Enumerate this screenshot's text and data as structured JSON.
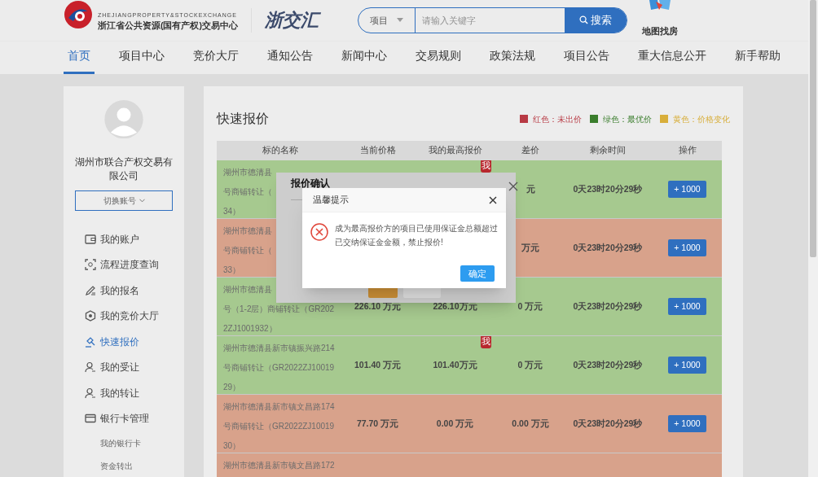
{
  "header": {
    "logo_subtitle": "ZHEJIANGPROPERTY&STOCKEXCHANGE",
    "logo_name": "浙江省公共资源(国有产权)交易中心",
    "brand": "浙交汇",
    "search": {
      "category": "项目",
      "placeholder": "请输入关键字",
      "button": "搜索"
    },
    "map_link": "地图找房"
  },
  "nav": [
    {
      "label": "首页",
      "selected": true
    },
    {
      "label": "项目中心",
      "selected": false
    },
    {
      "label": "竞价大厅",
      "selected": false
    },
    {
      "label": "通知公告",
      "selected": false
    },
    {
      "label": "新闻中心",
      "selected": false
    },
    {
      "label": "交易规则",
      "selected": false
    },
    {
      "label": "政策法规",
      "selected": false
    },
    {
      "label": "项目公告",
      "selected": false
    },
    {
      "label": "重大信息公开",
      "selected": false
    },
    {
      "label": "新手帮助",
      "selected": false
    }
  ],
  "sidebar": {
    "company": "湖州市联合产权交易有限公司",
    "switch_account": "切换账号",
    "items": [
      {
        "label": "我的账户",
        "selected": false
      },
      {
        "label": "流程进度查询",
        "selected": false
      },
      {
        "label": "我的报名",
        "selected": false
      },
      {
        "label": "我的竞价大厅",
        "selected": false
      },
      {
        "label": "快速报价",
        "selected": true
      },
      {
        "label": "我的受让",
        "selected": false
      },
      {
        "label": "我的转让",
        "selected": false
      },
      {
        "label": "银行卡管理",
        "selected": false,
        "children": [
          {
            "label": "我的银行卡"
          },
          {
            "label": "资金转出"
          }
        ]
      }
    ]
  },
  "quote": {
    "title": "快速报价",
    "legend": [
      {
        "label": "红色：未出价",
        "color": "#b83a44"
      },
      {
        "label": "绿色：最优价",
        "color": "#3a7d2c"
      },
      {
        "label": "黄色：价格变化",
        "color": "#d8ae3a"
      }
    ],
    "columns": [
      "标的名称",
      "当前价格",
      "我的最高报价",
      "差价",
      "剩余时间",
      "操作"
    ],
    "rows": [
      {
        "color": "#a6c98f",
        "name_lines": [
          "湖州市德清县",
          "号商铺转让（",
          "34）"
        ],
        "badge": "我",
        "diff": "元",
        "remaining": "0天23时20分29秒",
        "action": "+ 1000"
      },
      {
        "color": "#d8a28b",
        "name_lines": [
          "湖州市德清县",
          "号商铺转让（",
          "33）"
        ],
        "diff": "万元",
        "remaining": "0天23时20分29秒",
        "action": "+ 1000"
      },
      {
        "color": "#a6c98f",
        "name_lines": [
          "湖州市德清县",
          "号（1-2层）商铺转让（GR202",
          "2ZJ1001932）"
        ],
        "current_price": "226.10 万元",
        "my_max": "226.10万元",
        "diff": "0 万元",
        "remaining": "0天23时20分29秒",
        "action": "+ 1000"
      },
      {
        "color": "#a6c98f",
        "name_lines": [
          "湖州市德清县新市镇振兴路214",
          "号商铺转让（GR2022ZJ10019",
          "29）"
        ],
        "badge": "我",
        "current_price": "101.40 万元",
        "my_max": "101.40万元",
        "diff": "0 万元",
        "remaining": "0天23时20分29秒",
        "action": "+ 1000"
      },
      {
        "color": "#d8a28b",
        "name_lines": [
          "湖州市德清县新市镇文昌路174",
          "号商铺转让（GR2022ZJ10019",
          "30）"
        ],
        "current_price": "77.70 万元",
        "my_max": "0.00 万元",
        "diff": "0.00 万元",
        "remaining": "0天23时20分29秒",
        "action": "+ 1000"
      },
      {
        "color": "#d8a28b",
        "name_lines": [
          "湖州市德清县新市镇文昌路172"
        ]
      }
    ]
  },
  "confirm_dialog": {
    "title": "报价确认",
    "buttons": [
      {
        "kind": "primary"
      },
      {
        "kind": "default"
      }
    ]
  },
  "alert_dialog": {
    "title": "温馨提示",
    "message": "成为最高报价方的项目已使用保证金总额超过已交纳保证金金额，禁止报价!",
    "ok": "确定"
  }
}
